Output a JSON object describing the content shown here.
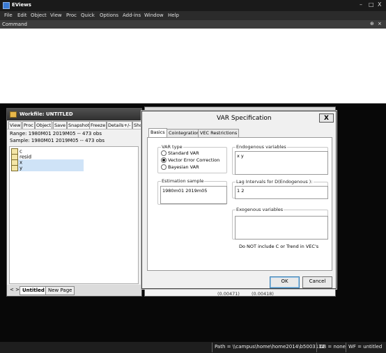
{
  "app": {
    "title": "EViews",
    "window_controls": [
      "–",
      "□",
      "X"
    ]
  },
  "menu": [
    "File",
    "Edit",
    "Object",
    "View",
    "Proc",
    "Quick",
    "Options",
    "Add-ins",
    "Window",
    "Help"
  ],
  "command": {
    "label": "Command",
    "controls": [
      "⊕",
      "×"
    ]
  },
  "workfile": {
    "title": "Workfile: UNTITLED",
    "toolbar": [
      "View",
      "Proc",
      "Object",
      "Save",
      "Snapshot",
      "Freeze",
      "Details+/-",
      "Sho"
    ],
    "range": "Range:  1980M01 2019M05  --  473 obs",
    "sample": "Sample: 1980M01 2019M05  --  473 obs",
    "objects": [
      {
        "name": "c",
        "icon": "coef-icon"
      },
      {
        "name": "resid",
        "icon": "series-icon"
      },
      {
        "name": "x",
        "icon": "series-icon"
      },
      {
        "name": "y",
        "icon": "series-icon"
      }
    ],
    "page_nav": "< >",
    "pages": [
      "Untitled",
      "New Page"
    ]
  },
  "bg_window": {
    "bottom_values": [
      "(0.00471)",
      "(0.00418)"
    ]
  },
  "dialog": {
    "title": "VAR Specification",
    "close": "X",
    "tabs": [
      "Basics",
      "Cointegration",
      "VEC Restrictions"
    ],
    "var_type": {
      "label": "VAR type",
      "options": [
        "Standard VAR",
        "Vector Error Correction",
        "Bayesian VAR"
      ],
      "selected_index": 1
    },
    "endogenous": {
      "label": "Endogenous variables",
      "value": "x y"
    },
    "estimation_sample": {
      "label": "Estimation sample",
      "value": "1980m01 2019m05"
    },
    "lag_intervals": {
      "label": "Lag Intervals for D(Endogenous ):",
      "value": "1 2"
    },
    "exogenous": {
      "label": "Exogenous variables",
      "value": ""
    },
    "note": "Do NOT include C or Trend in VEC's",
    "ok": "OK",
    "cancel": "Cancel"
  },
  "status": {
    "path": "Path = \\\\campus\\home\\home2014\\b5003132",
    "db": "DB = none",
    "wf": "WF = untitled"
  }
}
